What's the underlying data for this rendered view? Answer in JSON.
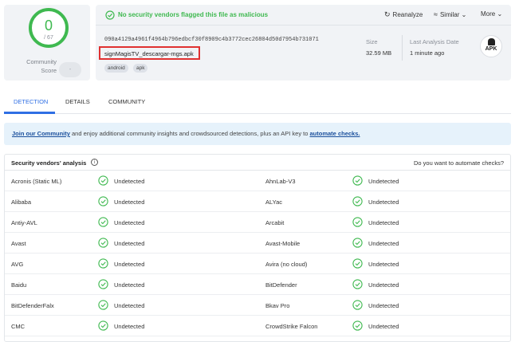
{
  "community": {
    "score": "0",
    "total": "/ 67",
    "label_line1": "Community",
    "label_line2": "Score",
    "vote_label": "-"
  },
  "verdict": {
    "message": "No security vendors flagged this file as malicious",
    "color": "#3fb950"
  },
  "toolbar": {
    "reanalyze": "Reanalyze",
    "similar": "Similar",
    "more": "More"
  },
  "file": {
    "hash": "090a4129a4961f4964b796edbcf30f8909c4b3772cec26804d50d7954b731071",
    "name": "signMagisTV_descargar-mgs.apk",
    "tags": [
      "android",
      "apk"
    ],
    "size_label": "Size",
    "size_value": "32.59 MB",
    "last_label": "Last Analysis Date",
    "last_value": "1 minute ago",
    "type_icon_text": "APK"
  },
  "tabs": [
    "DETECTION",
    "DETAILS",
    "COMMUNITY"
  ],
  "banner": {
    "link1": "Join our Community",
    "text_mid": " and enjoy additional community insights and crowdsourced detections, plus an API key to ",
    "link2": "automate checks."
  },
  "vendors": {
    "title": "Security vendors' analysis",
    "automate_question": "Do you want to automate checks?",
    "rows": [
      {
        "left": "Acronis (Static ML)",
        "left_result": "Undetected",
        "right": "AhnLab-V3",
        "right_result": "Undetected"
      },
      {
        "left": "Alibaba",
        "left_result": "Undetected",
        "right": "ALYac",
        "right_result": "Undetected"
      },
      {
        "left": "Antiy-AVL",
        "left_result": "Undetected",
        "right": "Arcabit",
        "right_result": "Undetected"
      },
      {
        "left": "Avast",
        "left_result": "Undetected",
        "right": "Avast-Mobile",
        "right_result": "Undetected"
      },
      {
        "left": "AVG",
        "left_result": "Undetected",
        "right": "Avira (no cloud)",
        "right_result": "Undetected"
      },
      {
        "left": "Baidu",
        "left_result": "Undetected",
        "right": "BitDefender",
        "right_result": "Undetected"
      },
      {
        "left": "BitDefenderFalx",
        "left_result": "Undetected",
        "right": "Bkav Pro",
        "right_result": "Undetected"
      },
      {
        "left": "CMC",
        "left_result": "Undetected",
        "right": "CrowdStrike Falcon",
        "right_result": "Undetected"
      }
    ]
  },
  "colors": {
    "accent": "#2f6fe4",
    "ok": "#3fb950",
    "highlight_box": "#e03131"
  }
}
